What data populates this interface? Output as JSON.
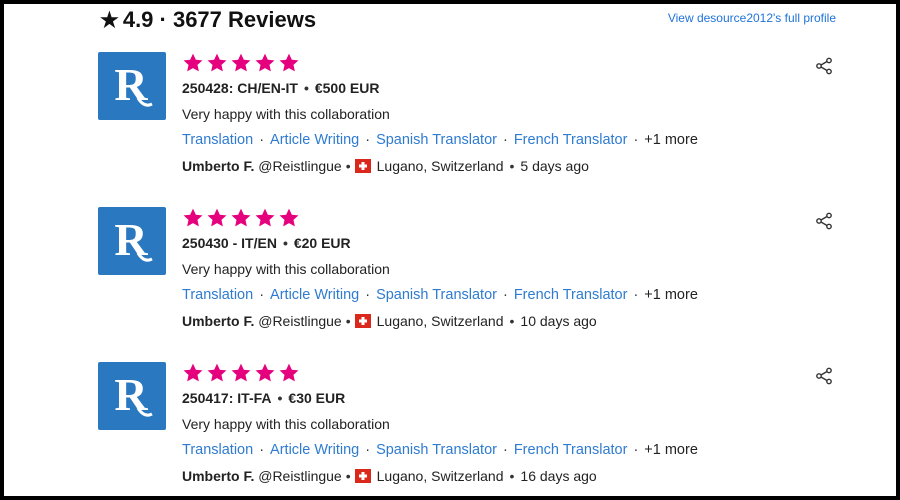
{
  "header": {
    "star_icon": "star-icon",
    "rating_text": "4.9 · 3677 Reviews",
    "profile_link": "View desource2012's full profile"
  },
  "colors": {
    "star": "#e5007d",
    "logo_bg": "#2a79c0",
    "link": "#2e7bd0",
    "flag_red": "#da291c"
  },
  "reviews": [
    {
      "logo_letter": "R",
      "stars": 5,
      "title": "250428: CH/EN-IT",
      "price": "€500 EUR",
      "comment": "Very happy with this collaboration",
      "tags": [
        "Translation",
        "Article Writing",
        "Spanish Translator",
        "French Translator"
      ],
      "more": "+1 more",
      "author": "Umberto F.",
      "handle": "@Reistlingue",
      "location": "Lugano, Switzerland",
      "time": "5 days ago"
    },
    {
      "logo_letter": "R",
      "stars": 5,
      "title": "250430 - IT/EN",
      "price": "€20 EUR",
      "comment": "Very happy with this collaboration",
      "tags": [
        "Translation",
        "Article Writing",
        "Spanish Translator",
        "French Translator"
      ],
      "more": "+1 more",
      "author": "Umberto F.",
      "handle": "@Reistlingue",
      "location": "Lugano, Switzerland",
      "time": "10 days ago"
    },
    {
      "logo_letter": "R",
      "stars": 5,
      "title": "250417: IT-FA",
      "price": "€30 EUR",
      "comment": "Very happy with this collaboration",
      "tags": [
        "Translation",
        "Article Writing",
        "Spanish Translator",
        "French Translator"
      ],
      "more": "+1 more",
      "author": "Umberto F.",
      "handle": "@Reistlingue",
      "location": "Lugano, Switzerland",
      "time": "16 days ago"
    }
  ]
}
